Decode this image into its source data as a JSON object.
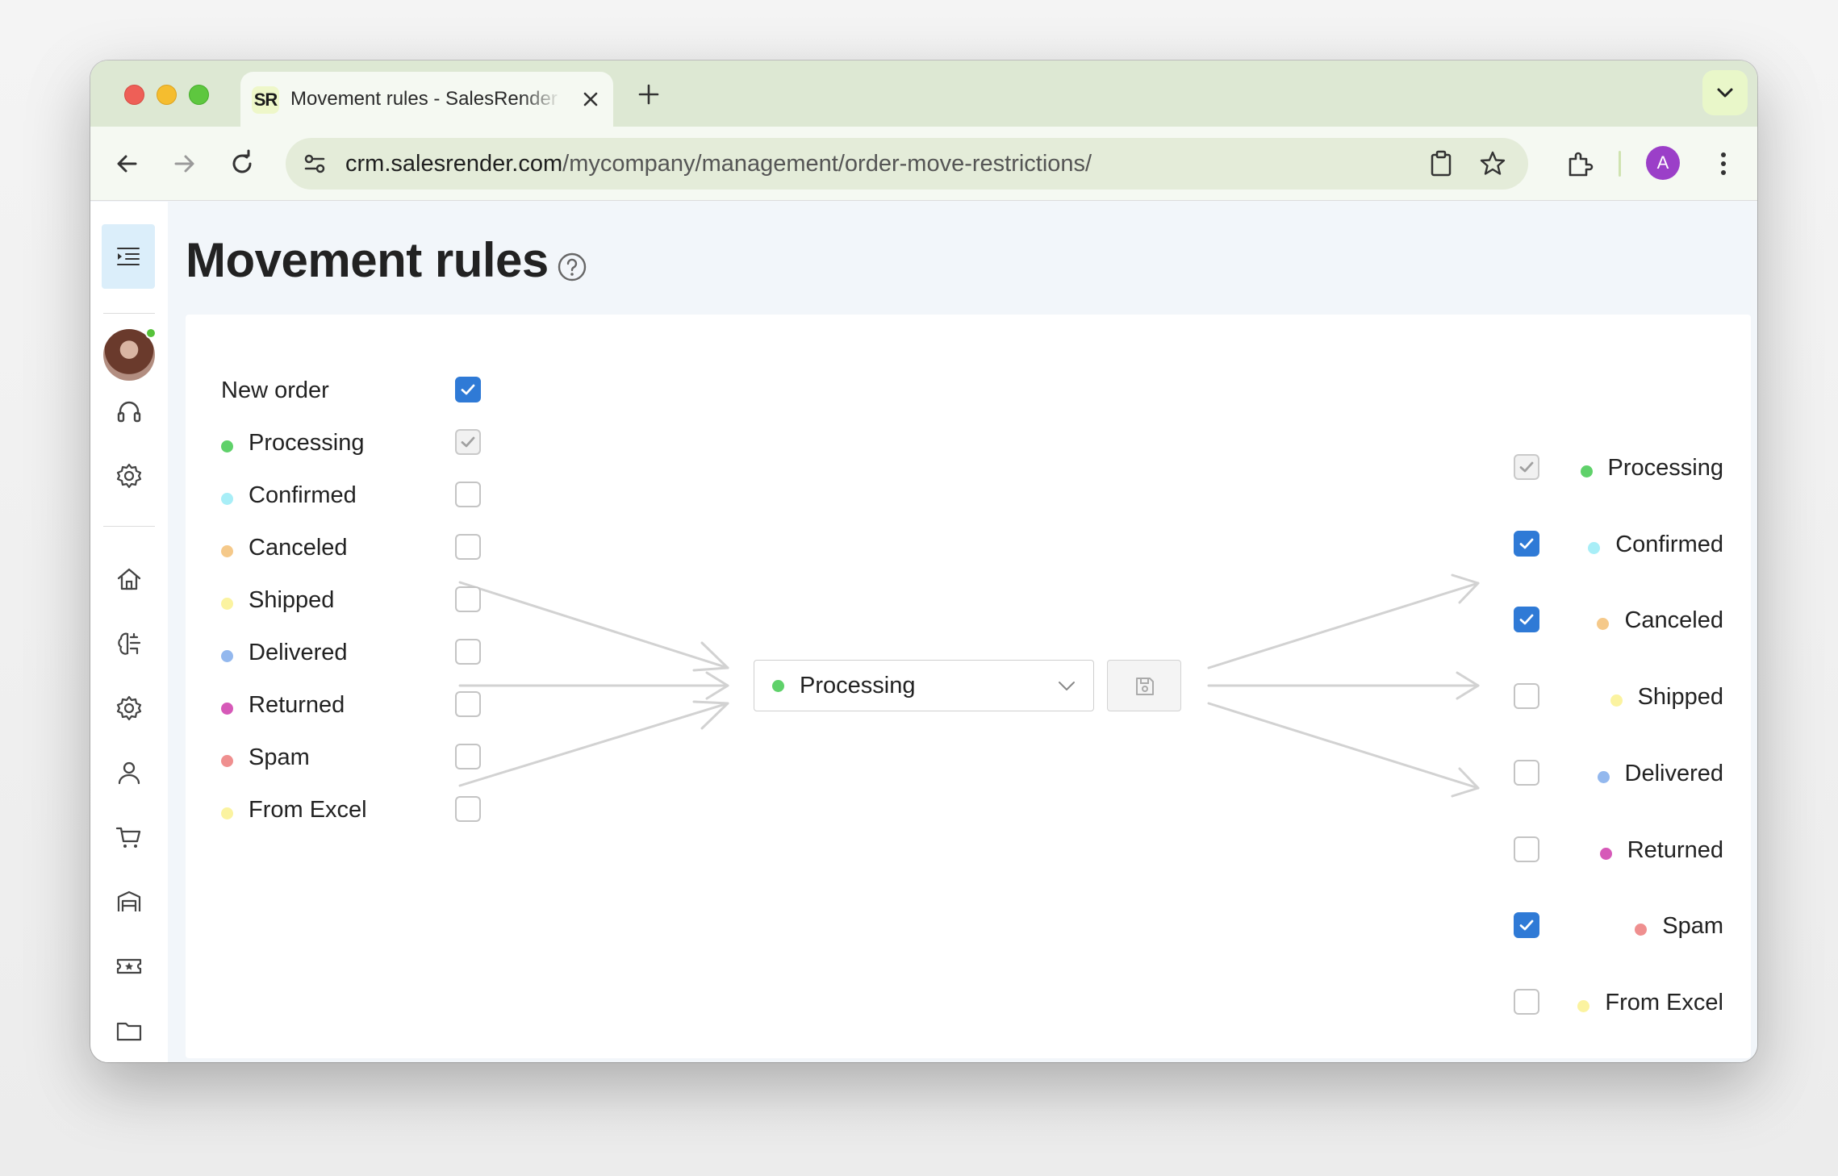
{
  "browser": {
    "tab_title": "Movement rules - SalesRender",
    "favicon_text": "SR",
    "url_host": "crm.salesrender.com",
    "url_path": "/mycompany/management/order-move-restrictions/",
    "profile_initial": "A"
  },
  "page": {
    "title": "Movement rules"
  },
  "colors": {
    "accent": "#2f7ad6",
    "processing": "#5fd16a",
    "confirmed": "#a8eef7",
    "canceled": "#f5c98a",
    "shipped": "#fbf3a0",
    "delivered": "#93b8ee",
    "returned": "#d659b8",
    "spam": "#ef8f8f",
    "from_excel": "#fbf3a0"
  },
  "from_statuses": [
    {
      "label": "New order",
      "checked": true,
      "disabled": false,
      "color": ""
    },
    {
      "label": "Processing",
      "checked": true,
      "disabled": true,
      "color": "#5fd16a"
    },
    {
      "label": "Confirmed",
      "checked": false,
      "disabled": false,
      "color": "#a8eef7"
    },
    {
      "label": "Canceled",
      "checked": false,
      "disabled": false,
      "color": "#f5c98a"
    },
    {
      "label": "Shipped",
      "checked": false,
      "disabled": false,
      "color": "#fbf3a0"
    },
    {
      "label": "Delivered",
      "checked": false,
      "disabled": false,
      "color": "#93b8ee"
    },
    {
      "label": "Returned",
      "checked": false,
      "disabled": false,
      "color": "#d659b8"
    },
    {
      "label": "Spam",
      "checked": false,
      "disabled": false,
      "color": "#ef8f8f"
    },
    {
      "label": "From Excel",
      "checked": false,
      "disabled": false,
      "color": "#fbf3a0"
    }
  ],
  "selected_status": {
    "label": "Processing",
    "color": "#5fd16a"
  },
  "to_statuses": [
    {
      "label": "Processing",
      "checked": true,
      "disabled": true,
      "color": "#5fd16a"
    },
    {
      "label": "Confirmed",
      "checked": true,
      "disabled": false,
      "color": "#a8eef7"
    },
    {
      "label": "Canceled",
      "checked": true,
      "disabled": false,
      "color": "#f5c98a"
    },
    {
      "label": "Shipped",
      "checked": false,
      "disabled": false,
      "color": "#fbf3a0"
    },
    {
      "label": "Delivered",
      "checked": false,
      "disabled": false,
      "color": "#93b8ee"
    },
    {
      "label": "Returned",
      "checked": false,
      "disabled": false,
      "color": "#d659b8"
    },
    {
      "label": "Spam",
      "checked": true,
      "disabled": false,
      "color": "#ef8f8f"
    },
    {
      "label": "From Excel",
      "checked": false,
      "disabled": false,
      "color": "#fbf3a0"
    }
  ],
  "sidebar_icons": [
    "menu-indent-icon",
    "avatar",
    "headset-icon",
    "gear-icon",
    "home-icon",
    "brain-icon",
    "gear-icon",
    "user-icon",
    "cart-icon",
    "warehouse-icon",
    "ticket-icon",
    "folder-icon"
  ]
}
